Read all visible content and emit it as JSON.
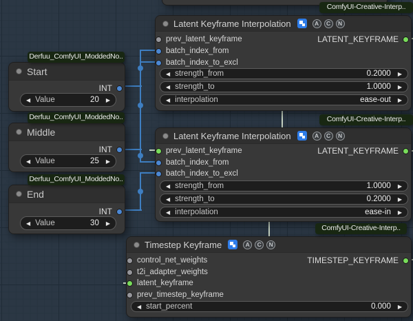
{
  "ui": {
    "arrow_left": "◀",
    "arrow_right": "▶"
  },
  "colors": {
    "background": "#2b3744",
    "link_int": "#3e7ec1",
    "link_latent_keyframe": "#c9d6c5",
    "slot_int": "#4c87d2",
    "slot_connected": "#78dc5a",
    "slot_unconnected": "#96969b",
    "title_badge_blue": "#2e7ce8"
  },
  "acn": [
    "A",
    "C",
    "N"
  ],
  "badges": {
    "derfuu": "Derfuu_ComfyUI_ModdedNo..",
    "creative": "ComfyUI-Creative-Interp.."
  },
  "int_nodes": [
    {
      "title": "Start",
      "output_type": "INT",
      "widget": {
        "label": "Value",
        "value": "20"
      }
    },
    {
      "title": "Middle",
      "output_type": "INT",
      "widget": {
        "label": "Value",
        "value": "25"
      }
    },
    {
      "title": "End",
      "output_type": "INT",
      "widget": {
        "label": "Value",
        "value": "30"
      }
    }
  ],
  "latent_nodes": [
    {
      "title": "Latent Keyframe Interpolation",
      "inputs": [
        "prev_latent_keyframe",
        "batch_index_from",
        "batch_index_to_excl"
      ],
      "output": "LATENT_KEYFRAME",
      "widgets": [
        {
          "label": "strength_from",
          "value": "0.2000"
        },
        {
          "label": "strength_to",
          "value": "1.0000"
        },
        {
          "label": "interpolation",
          "value": "ease-out"
        }
      ]
    },
    {
      "title": "Latent Keyframe Interpolation",
      "inputs": [
        "prev_latent_keyframe",
        "batch_index_from",
        "batch_index_to_excl"
      ],
      "output": "LATENT_KEYFRAME",
      "widgets": [
        {
          "label": "strength_from",
          "value": "1.0000"
        },
        {
          "label": "strength_to",
          "value": "0.2000"
        },
        {
          "label": "interpolation",
          "value": "ease-in"
        }
      ]
    }
  ],
  "timestep_node": {
    "title": "Timestep Keyframe",
    "inputs": [
      "control_net_weights",
      "t2i_adapter_weights",
      "latent_keyframe",
      "prev_timestep_keyframe"
    ],
    "output": "TIMESTEP_KEYFRAME",
    "widgets": [
      {
        "label": "start_percent",
        "value": "0.000"
      }
    ]
  }
}
